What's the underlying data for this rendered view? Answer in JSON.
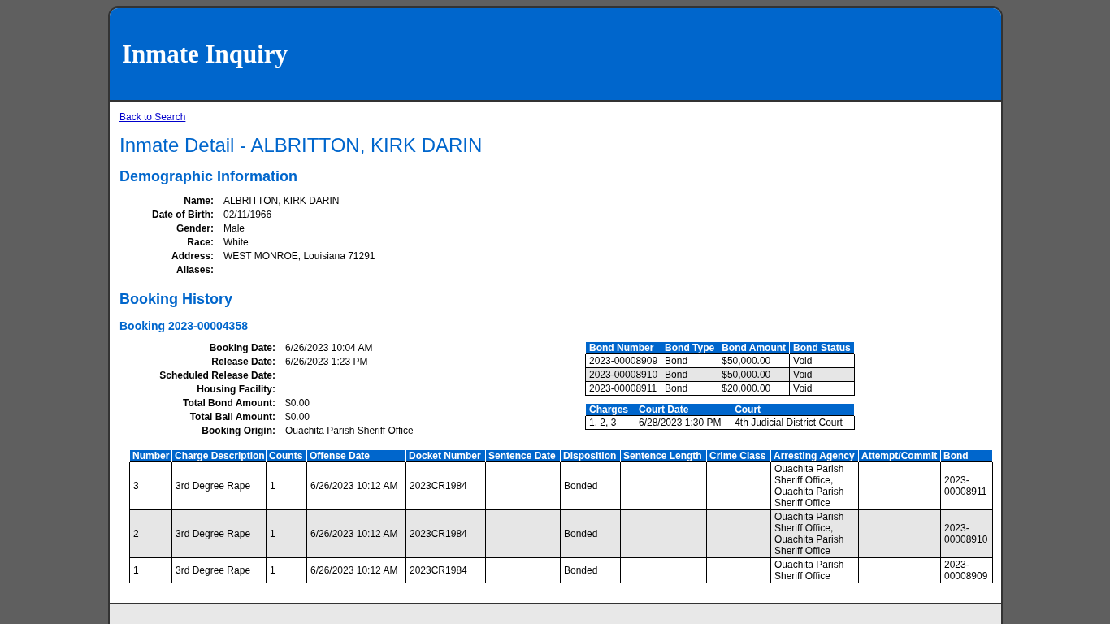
{
  "header": {
    "title": "Inmate Inquiry"
  },
  "back_link": "Back to Search",
  "page_title": "Inmate Detail - ALBRITTON, KIRK DARIN",
  "demographics": {
    "heading": "Demographic Information",
    "fields": [
      {
        "label": "Name:",
        "value": "ALBRITTON, KIRK DARIN"
      },
      {
        "label": "Date of Birth:",
        "value": "02/11/1966"
      },
      {
        "label": "Gender:",
        "value": "Male"
      },
      {
        "label": "Race:",
        "value": "White"
      },
      {
        "label": "Address:",
        "value": "WEST MONROE, Louisiana 71291"
      },
      {
        "label": "Aliases:"
      }
    ]
  },
  "booking_history": {
    "heading": "Booking History",
    "booking": {
      "heading": "Booking 2023-00004358",
      "fields": [
        {
          "label": "Booking Date:",
          "value": "6/26/2023 10:04 AM"
        },
        {
          "label": "Release Date:",
          "value": "6/26/2023 1:23 PM"
        },
        {
          "label": "Scheduled Release Date:"
        },
        {
          "label": "Housing Facility:"
        },
        {
          "label": "Total Bond Amount:",
          "value": "$0.00"
        },
        {
          "label": "Total Bail Amount:",
          "value": "$0.00"
        },
        {
          "label": "Booking Origin:",
          "value": "Ouachita Parish Sheriff Office"
        }
      ],
      "bonds": {
        "columns": [
          "Bond Number",
          "Bond Type",
          "Bond Amount",
          "Bond Status"
        ],
        "rows": [
          [
            "2023-00008909",
            "Bond",
            "$50,000.00",
            "Void"
          ],
          [
            "2023-00008910",
            "Bond",
            "$50,000.00",
            "Void"
          ],
          [
            "2023-00008911",
            "Bond",
            "$20,000.00",
            "Void"
          ]
        ]
      },
      "court": {
        "columns": [
          "Charges",
          "Court Date",
          "Court"
        ],
        "rows": [
          [
            "1, 2, 3",
            "6/28/2023 1:30 PM",
            "4th Judicial District Court"
          ]
        ]
      },
      "charges": {
        "columns": [
          "Number",
          "Charge Description",
          "Counts",
          "Offense Date",
          "Docket Number",
          "Sentence Date",
          "Disposition",
          "Sentence Length",
          "Crime Class",
          "Arresting Agency",
          "Attempt/Commit",
          "Bond"
        ],
        "rows": [
          [
            "3",
            "3rd Degree Rape",
            "1",
            "6/26/2023 10:12 AM",
            "2023CR1984",
            null,
            "Bonded",
            null,
            null,
            "Ouachita Parish Sheriff Office, Ouachita Parish Sheriff Office",
            null,
            "2023-00008911"
          ],
          [
            "2",
            "3rd Degree Rape",
            "1",
            "6/26/2023 10:12 AM",
            "2023CR1984",
            null,
            "Bonded",
            null,
            null,
            "Ouachita Parish Sheriff Office, Ouachita Parish Sheriff Office",
            null,
            "2023-00008910"
          ],
          [
            "1",
            "3rd Degree Rape",
            "1",
            "6/26/2023 10:12 AM",
            "2023CR1984",
            null,
            "Bonded",
            null,
            null,
            "Ouachita Parish Sheriff Office",
            null,
            "2023-00008909"
          ]
        ]
      }
    }
  }
}
